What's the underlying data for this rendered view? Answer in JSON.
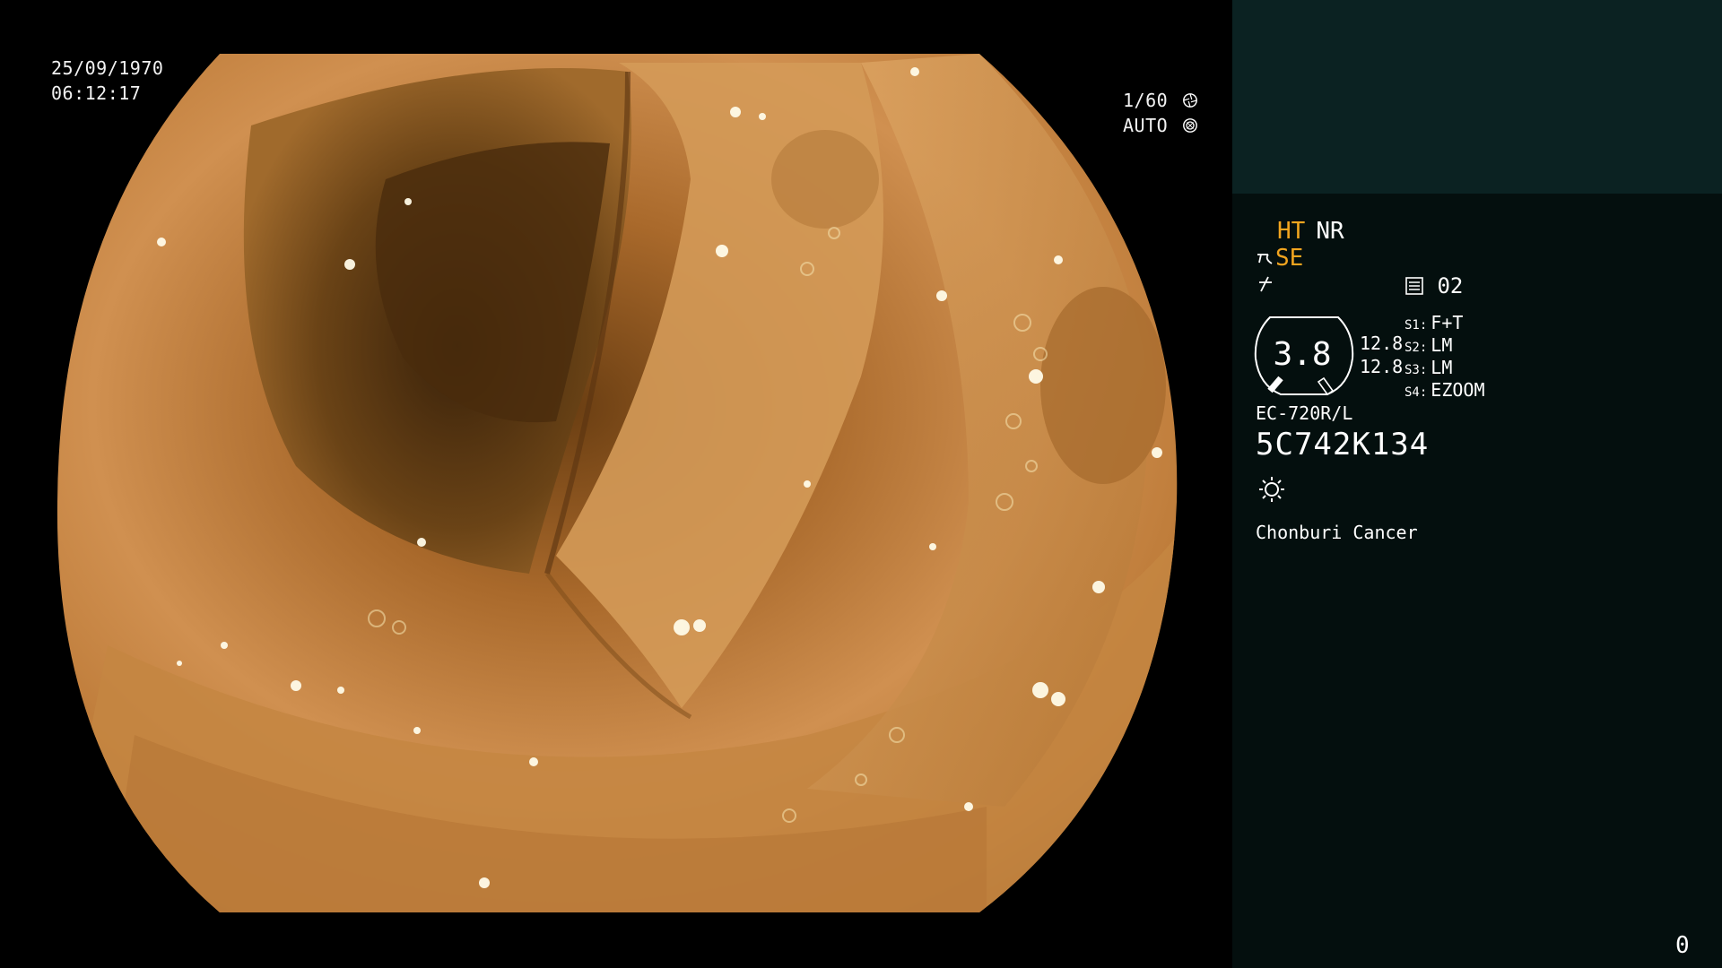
{
  "overlay": {
    "date": "25/09/1970",
    "time": "06:12:17",
    "shutter": "1/60",
    "iris": "AUTO",
    "shutter_icon": "aperture-icon",
    "iris_icon": "iris-icon"
  },
  "panel": {
    "ht": "HT",
    "nr": "NR",
    "se": "SE",
    "se_icon": "structure-enhancement-icon",
    "filter_icon": "color-mode-icon",
    "memory_icon": "memory-card-icon",
    "memory": "02",
    "zoom": "3.8",
    "zoom_a": "12.8",
    "zoom_b": "12.8",
    "switches": [
      {
        "key": "S1:",
        "value": "F+T"
      },
      {
        "key": "S2:",
        "value": "LM"
      },
      {
        "key": "S3:",
        "value": "LM"
      },
      {
        "key": "S4:",
        "value": "EZOOM"
      }
    ],
    "scope_model": "EC-720R/L",
    "scope_serial": "5C742K134",
    "light_icon": "light-source-icon",
    "hospital": "Chonburi Cancer",
    "counter": "0"
  },
  "colors": {
    "panel_bg": "#040f0e",
    "panel_header_bg": "#0b2222",
    "accent_amber": "#f2a51f",
    "mucosa": "#c98a3e"
  }
}
